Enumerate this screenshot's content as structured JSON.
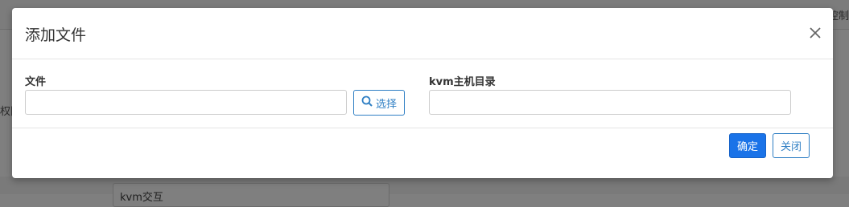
{
  "background": {
    "top_right_text": "控制",
    "left_label": "权限",
    "bottom_input_value": "kvm交互"
  },
  "modal": {
    "title": "添加文件",
    "close_icon": "close-icon",
    "fields": {
      "file_label": "文件",
      "file_value": "",
      "select_button": "选择",
      "select_icon": "search-icon",
      "kvm_dir_label": "kvm主机目录",
      "kvm_dir_value": ""
    },
    "footer": {
      "confirm_label": "确定",
      "close_label": "关闭"
    }
  },
  "colors": {
    "primary": "#1a73e8",
    "link": "#2f7fc4",
    "overlay": "#7f7f7f"
  }
}
